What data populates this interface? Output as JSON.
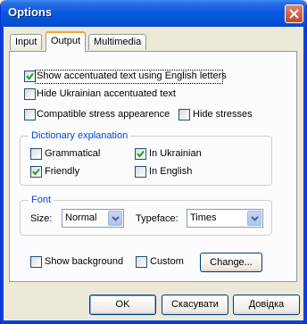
{
  "window": {
    "title": "Options"
  },
  "tabs": [
    {
      "label": "Input"
    },
    {
      "label": "Output"
    },
    {
      "label": "Multimedia"
    }
  ],
  "output": {
    "show_accentuated": {
      "label": "Show accentuated text using English letters",
      "checked": true
    },
    "hide_ukrainian": {
      "label": "Hide Ukrainian accentuated text",
      "checked": false
    },
    "compatible_stress": {
      "label": "Compatible stress appearence",
      "checked": false
    },
    "hide_stresses": {
      "label": "Hide stresses",
      "checked": false
    }
  },
  "dictionary": {
    "title": "Dictionary explanation",
    "grammatical": {
      "label": "Grammatical",
      "checked": false
    },
    "friendly": {
      "label": "Friendly",
      "checked": true
    },
    "in_ukrainian": {
      "label": "In Ukrainian",
      "checked": true
    },
    "in_english": {
      "label": "In English",
      "checked": false
    }
  },
  "font": {
    "title": "Font",
    "size_label": "Size:",
    "size_value": "Normal",
    "typeface_label": "Typeface:",
    "typeface_value": "Times"
  },
  "background": {
    "show_background": {
      "label": "Show background",
      "checked": false
    },
    "custom": {
      "label": "Custom",
      "checked": false
    },
    "change_button": "Change..."
  },
  "buttons": {
    "ok": "OK",
    "cancel": "Скасувати",
    "help": "Довідка"
  },
  "colors": {
    "titlebar": "#0a5ae0",
    "group_title": "#0046d5",
    "tab_highlight": "#f0a23a",
    "check": "#21a121"
  }
}
